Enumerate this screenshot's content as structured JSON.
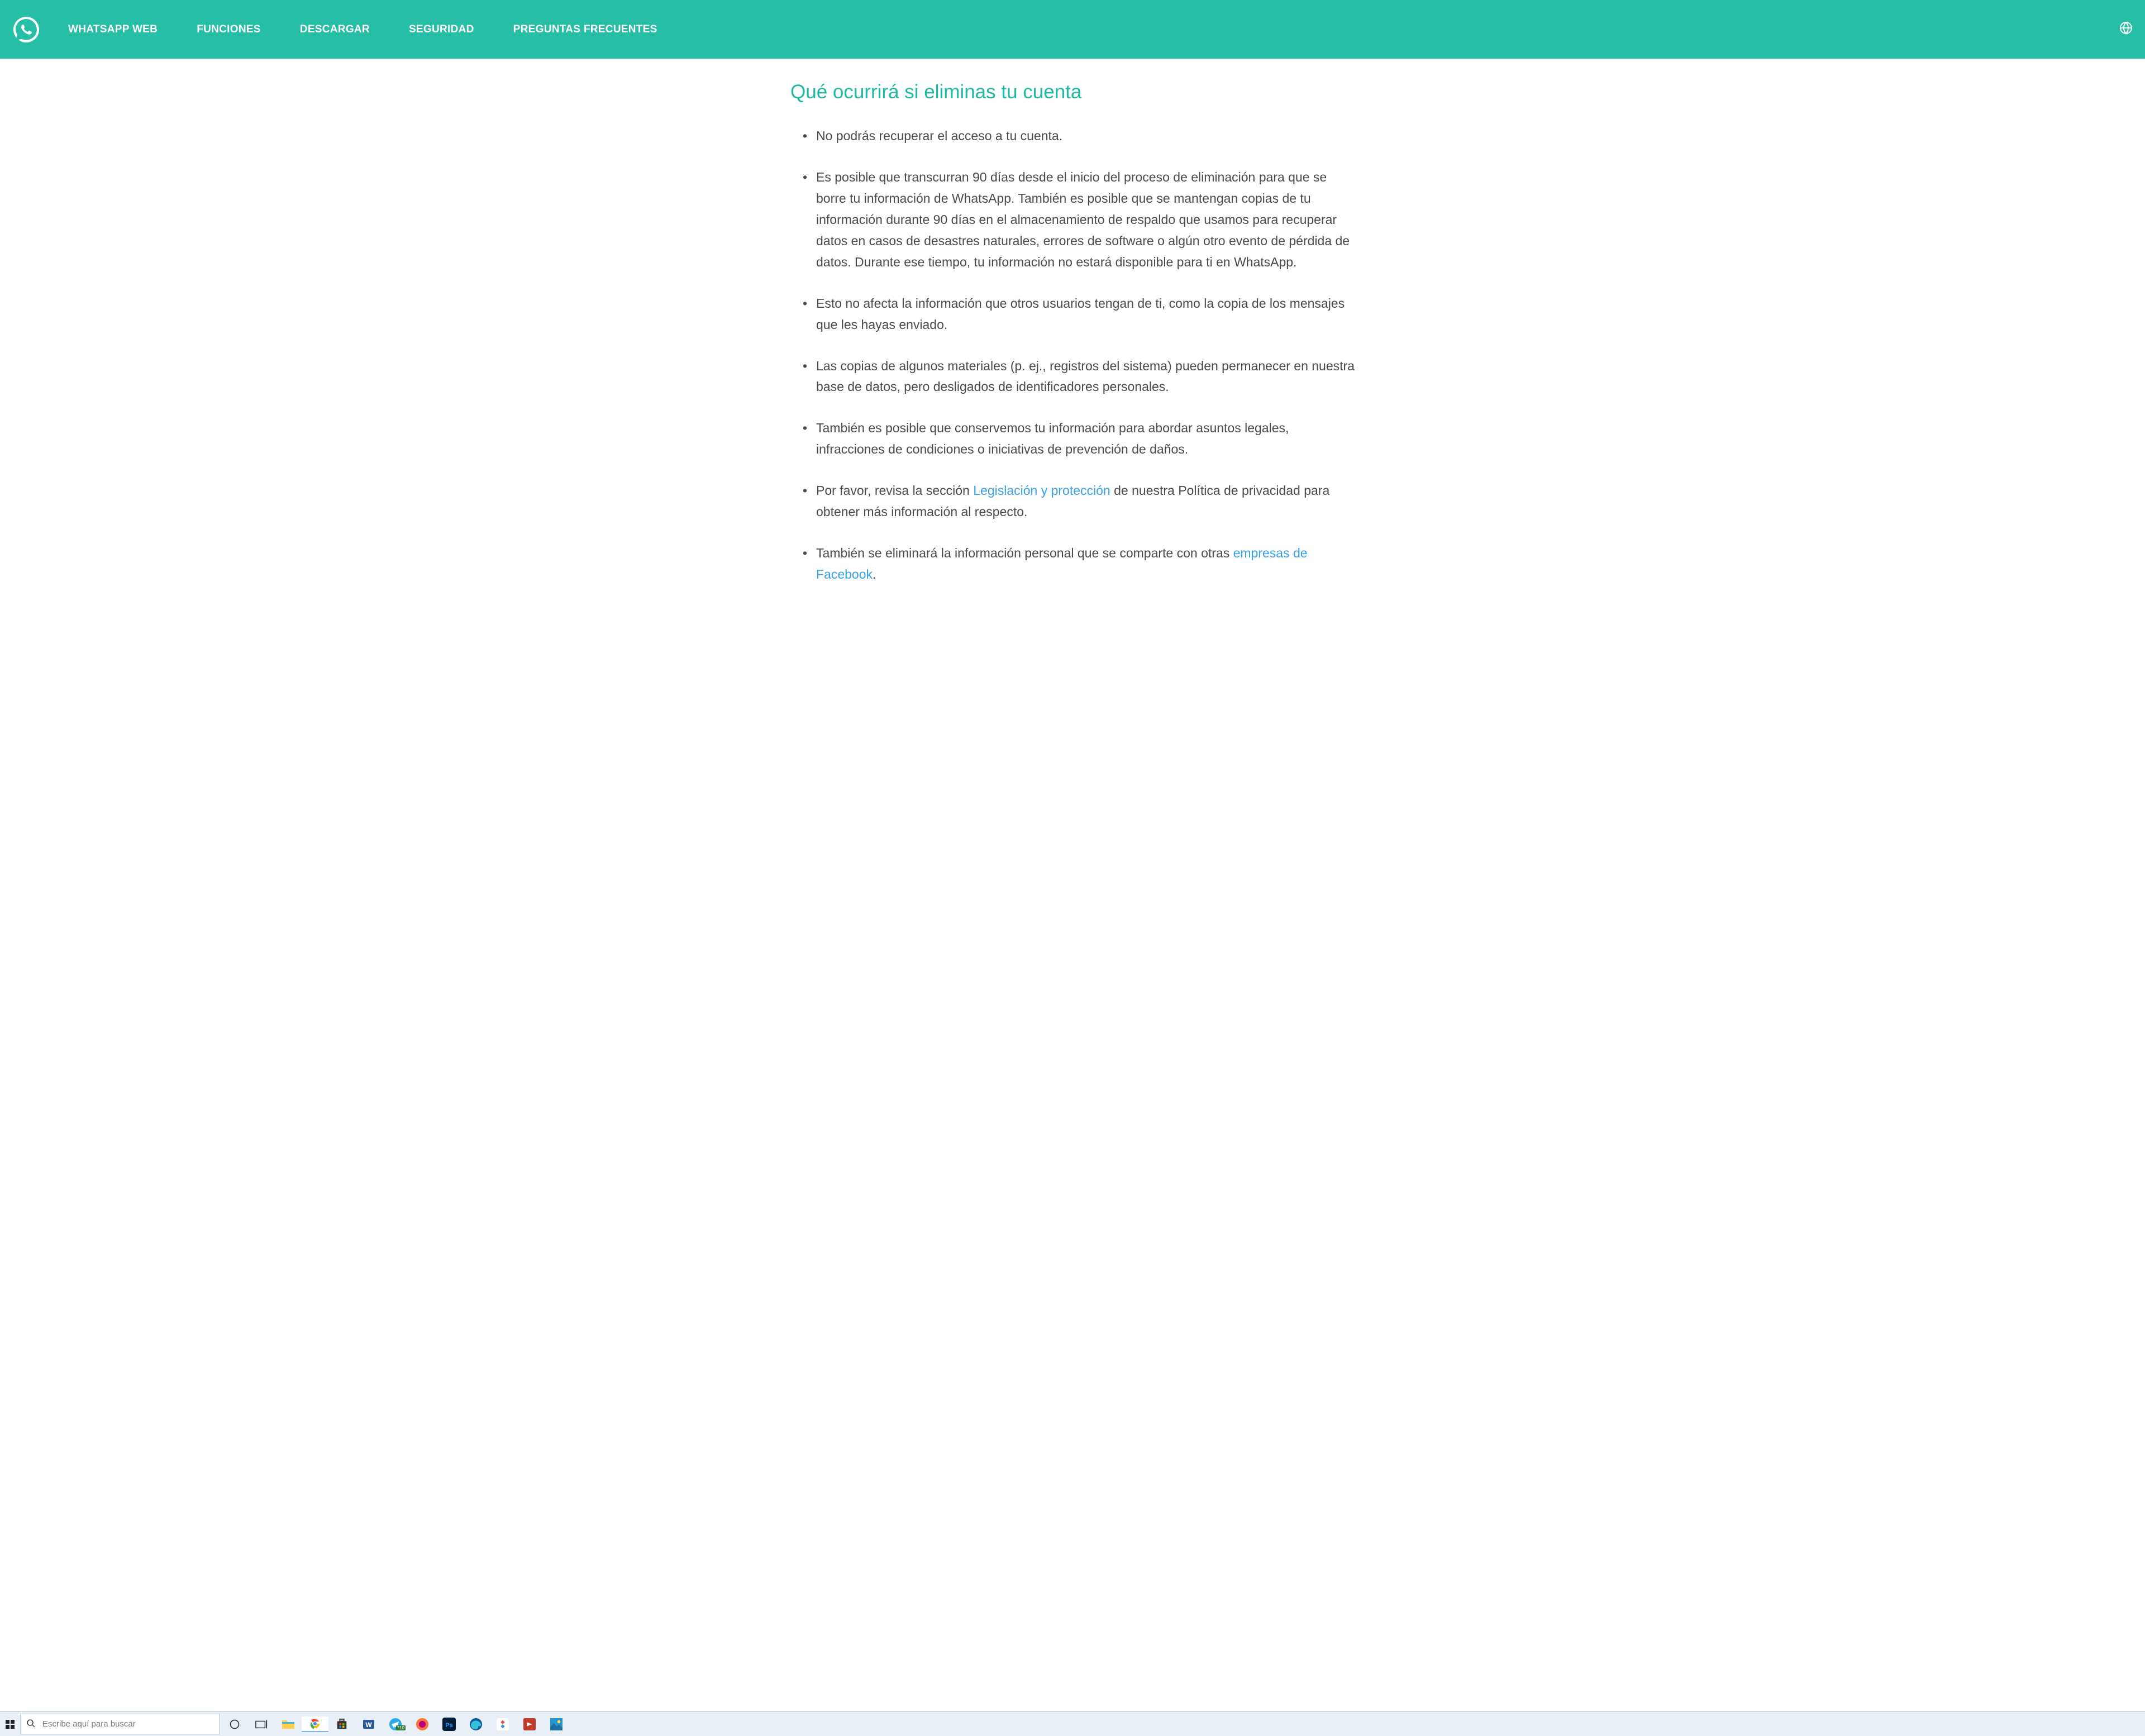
{
  "nav": {
    "items": [
      "WHATSAPP WEB",
      "FUNCIONES",
      "DESCARGAR",
      "SEGURIDAD",
      "PREGUNTAS FRECUENTES"
    ]
  },
  "article": {
    "title": "Qué ocurrirá si eliminas tu cuenta",
    "bullets": [
      {
        "segments": [
          {
            "t": "No podrás recuperar el acceso a tu cuenta."
          }
        ]
      },
      {
        "segments": [
          {
            "t": "Es posible que transcurran 90 días desde el inicio del proceso de eliminación para que se borre tu información de WhatsApp. También es posible que se mantengan copias de tu información durante 90 días en el almacenamiento de respaldo que usamos para recuperar datos en casos de desastres naturales, errores de software o algún otro evento de pérdida de datos. Durante ese tiempo, tu información no estará disponible para ti en WhatsApp."
          }
        ]
      },
      {
        "segments": [
          {
            "t": "Esto no afecta la información que otros usuarios tengan de ti, como la copia de los mensajes que les hayas enviado."
          }
        ]
      },
      {
        "segments": [
          {
            "t": "Las copias de algunos materiales (p. ej., registros del sistema) pueden permanecer en nuestra base de datos, pero desligados de identificadores personales."
          }
        ]
      },
      {
        "segments": [
          {
            "t": "También es posible que conservemos tu información para abordar asuntos legales, infracciones de condiciones o iniciativas de prevención de daños."
          }
        ]
      },
      {
        "segments": [
          {
            "t": "Por favor, revisa la sección "
          },
          {
            "t": "Legislación y protección",
            "link": true
          },
          {
            "t": " de nuestra Política de privacidad para obtener más información al respecto."
          }
        ]
      },
      {
        "segments": [
          {
            "t": "También se eliminará la información personal que se comparte con otras "
          },
          {
            "t": "empresas de Facebook",
            "link": true
          },
          {
            "t": "."
          }
        ]
      }
    ]
  },
  "taskbar": {
    "search_placeholder": "Escribe aquí para buscar",
    "telegram_badge": "710"
  }
}
